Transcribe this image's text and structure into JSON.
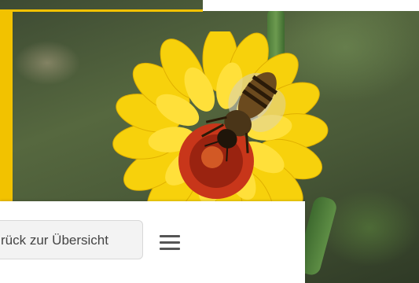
{
  "nav": {
    "back_label": "rück zur Übersicht",
    "menu_icon": "hamburger-menu-icon"
  },
  "photo": {
    "subject_icon": "bee-on-flower-photo"
  },
  "colors": {
    "accent": "#f2c200",
    "panel": "#ffffff",
    "button_bg": "#f3f3f3"
  }
}
